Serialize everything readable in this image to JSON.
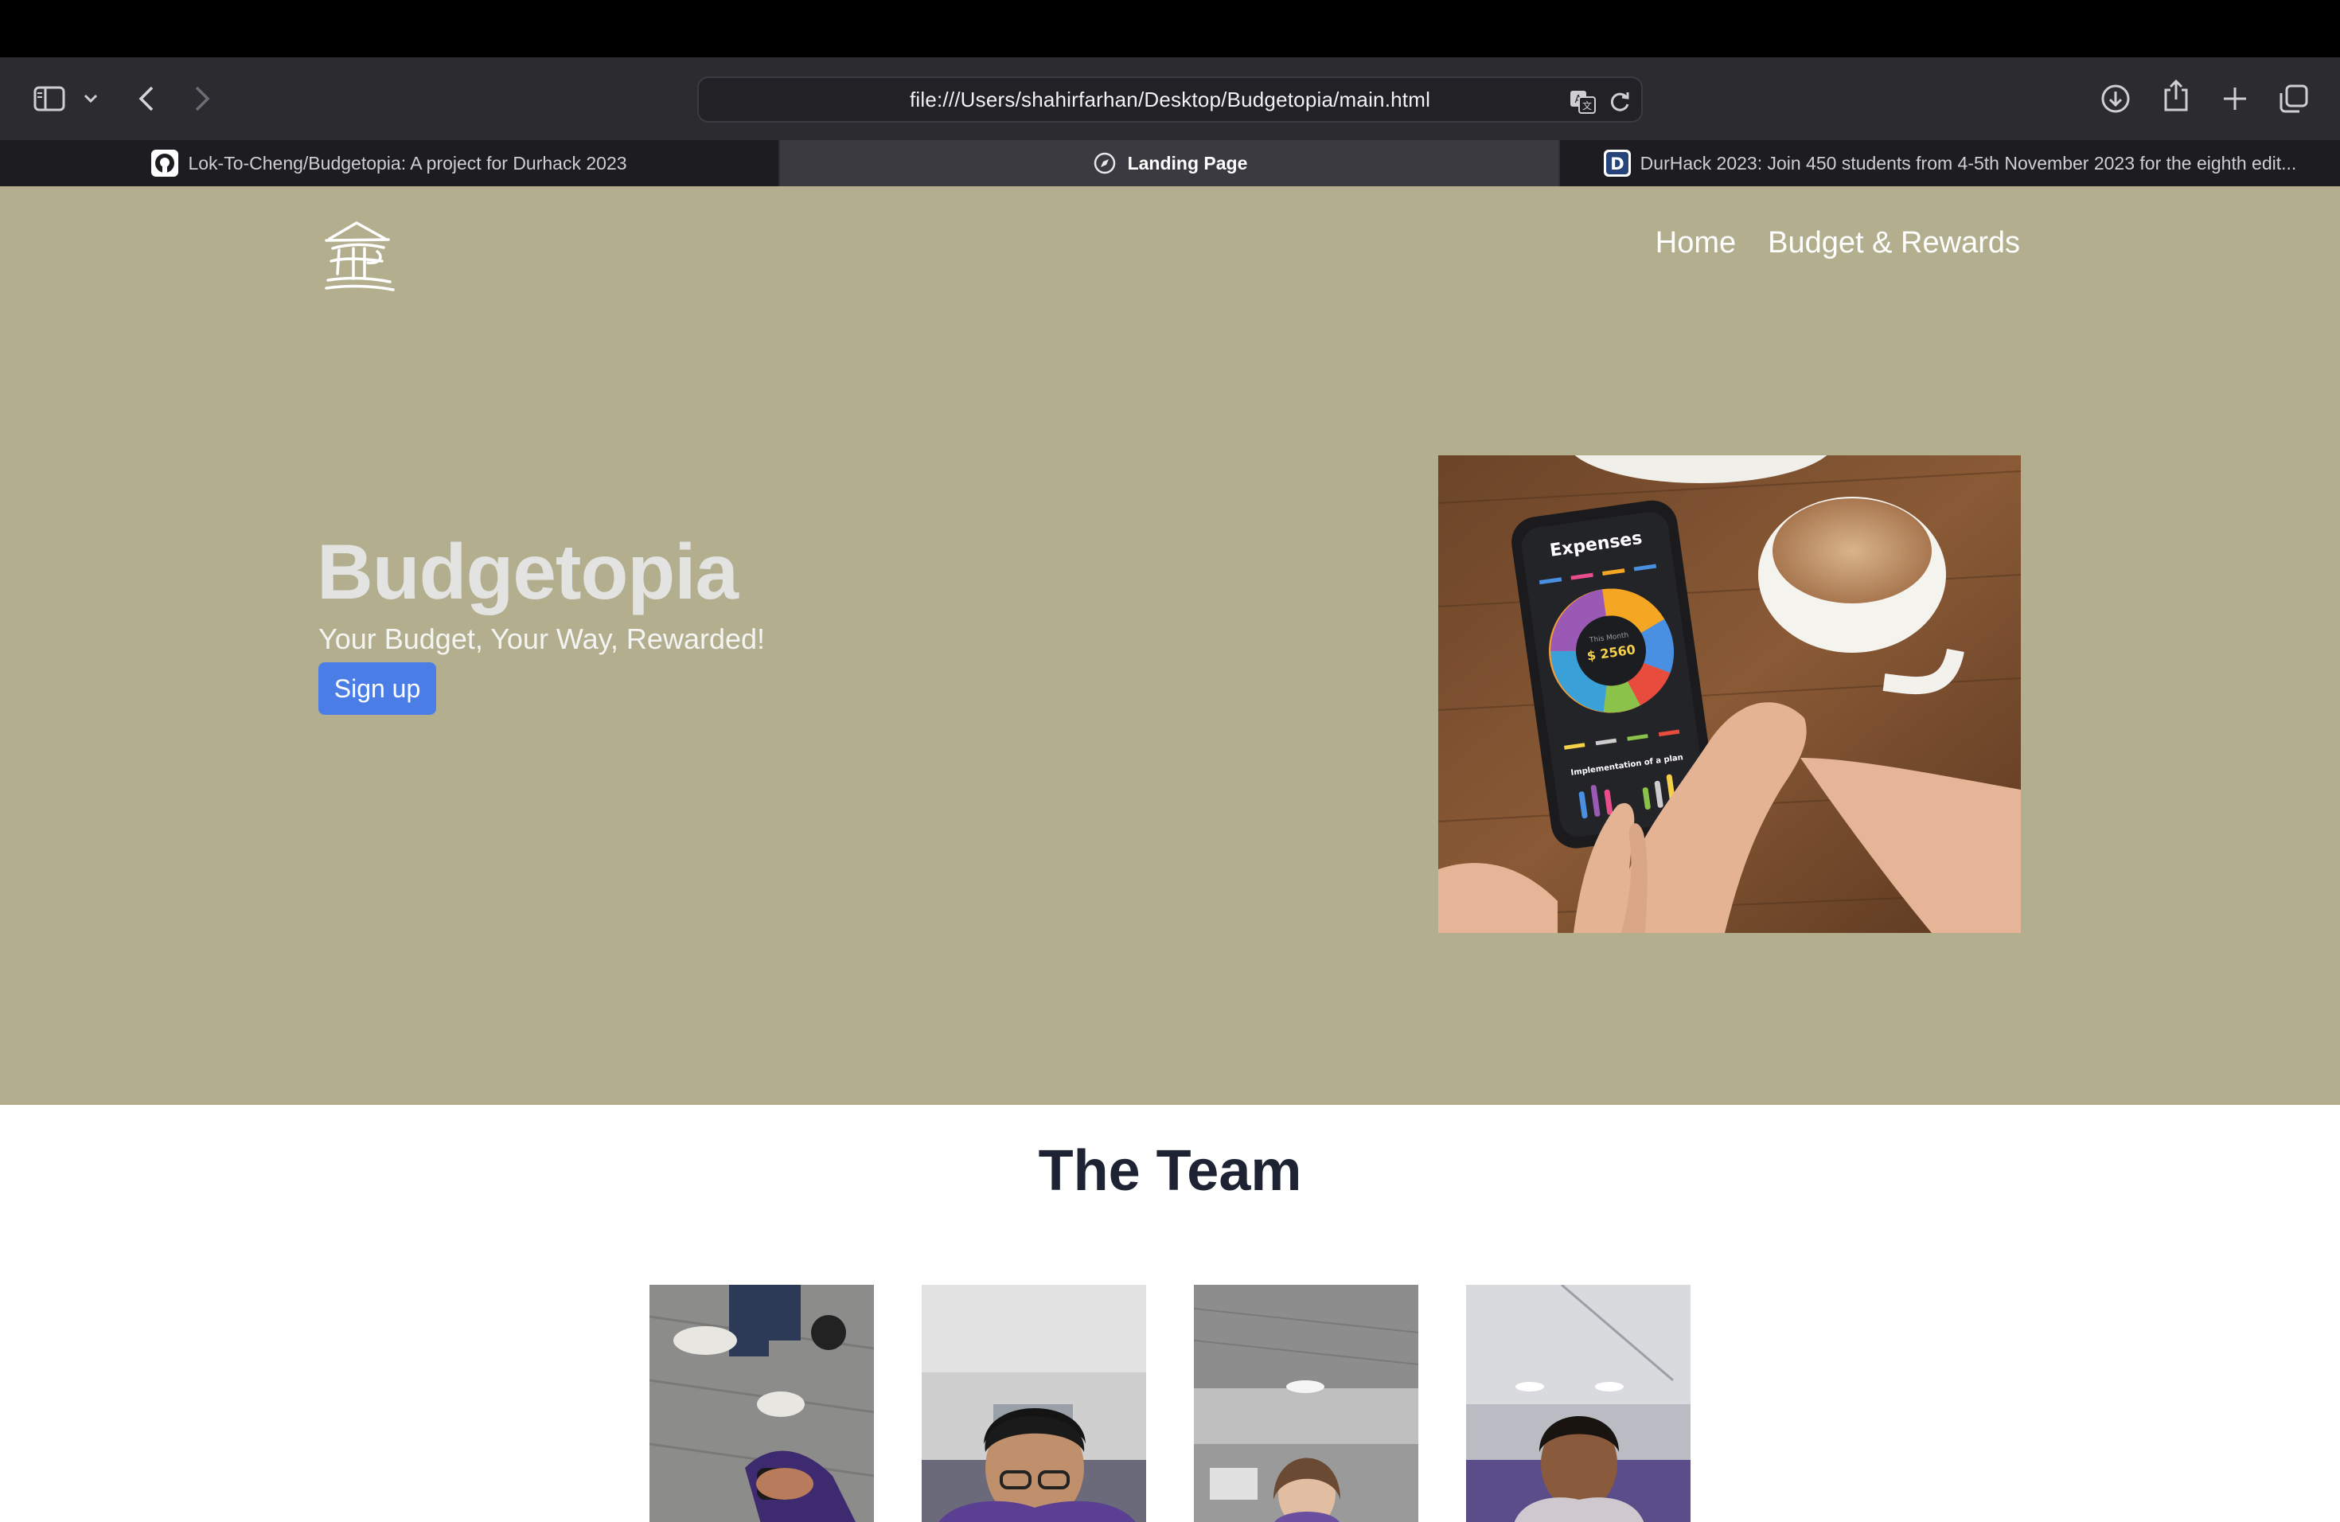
{
  "browser": {
    "address": "file:///Users/shahirfarhan/Desktop/Budgetopia/main.html",
    "tabs": [
      {
        "label": "Lok-To-Cheng/Budgetopia: A project for Durhack 2023",
        "icon": "github-icon",
        "active": false
      },
      {
        "label": "Landing Page",
        "icon": "compass-icon",
        "active": true
      },
      {
        "label": "DurHack 2023: Join 450 students from 4-5th November 2023 for the eighth edit...",
        "icon": "durhack-d-icon",
        "active": false
      }
    ]
  },
  "site": {
    "nav": [
      "Home",
      "Budget & Rewards"
    ],
    "hero": {
      "title": "Budgetopia",
      "subtitle": "Your Budget, Your Way, Rewarded!",
      "cta": "Sign up"
    },
    "phone_app": {
      "header": "Expenses",
      "center_caption": "This Month",
      "amount": "$ 2560",
      "footer": "Implementation of a plan"
    },
    "team_title": "The Team"
  },
  "colors": {
    "hero_bg": "#b2ae8e",
    "cta_bg": "#4a7ee6",
    "toolbar_bg": "#2b2b30"
  }
}
